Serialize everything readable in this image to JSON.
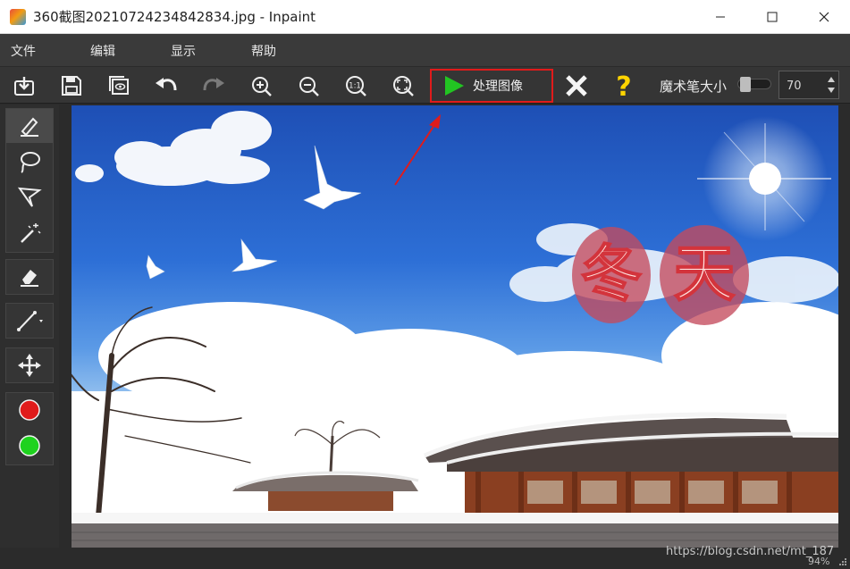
{
  "window": {
    "title": "360截图20210724234842834.jpg - Inpaint",
    "minimize": "—",
    "maximize": "☐",
    "close": "✕"
  },
  "menu": [
    "文件",
    "编辑",
    "显示",
    "帮助"
  ],
  "toolbar": {
    "process_label": "处理图像",
    "magic_brush_label": "魔术笔大小",
    "magic_brush_size": "70",
    "magic_brush_level": 0.1
  },
  "status": {
    "watermark": "https://blog.csdn.net/mt_187",
    "zoom": "94%"
  },
  "image": {
    "overlay_chars": [
      "冬",
      "天"
    ]
  },
  "colors": {
    "marker_red": "#e01b1b",
    "marker_green": "#1ed21e",
    "accent_green": "#22c422",
    "help_yellow": "#ffd400"
  }
}
